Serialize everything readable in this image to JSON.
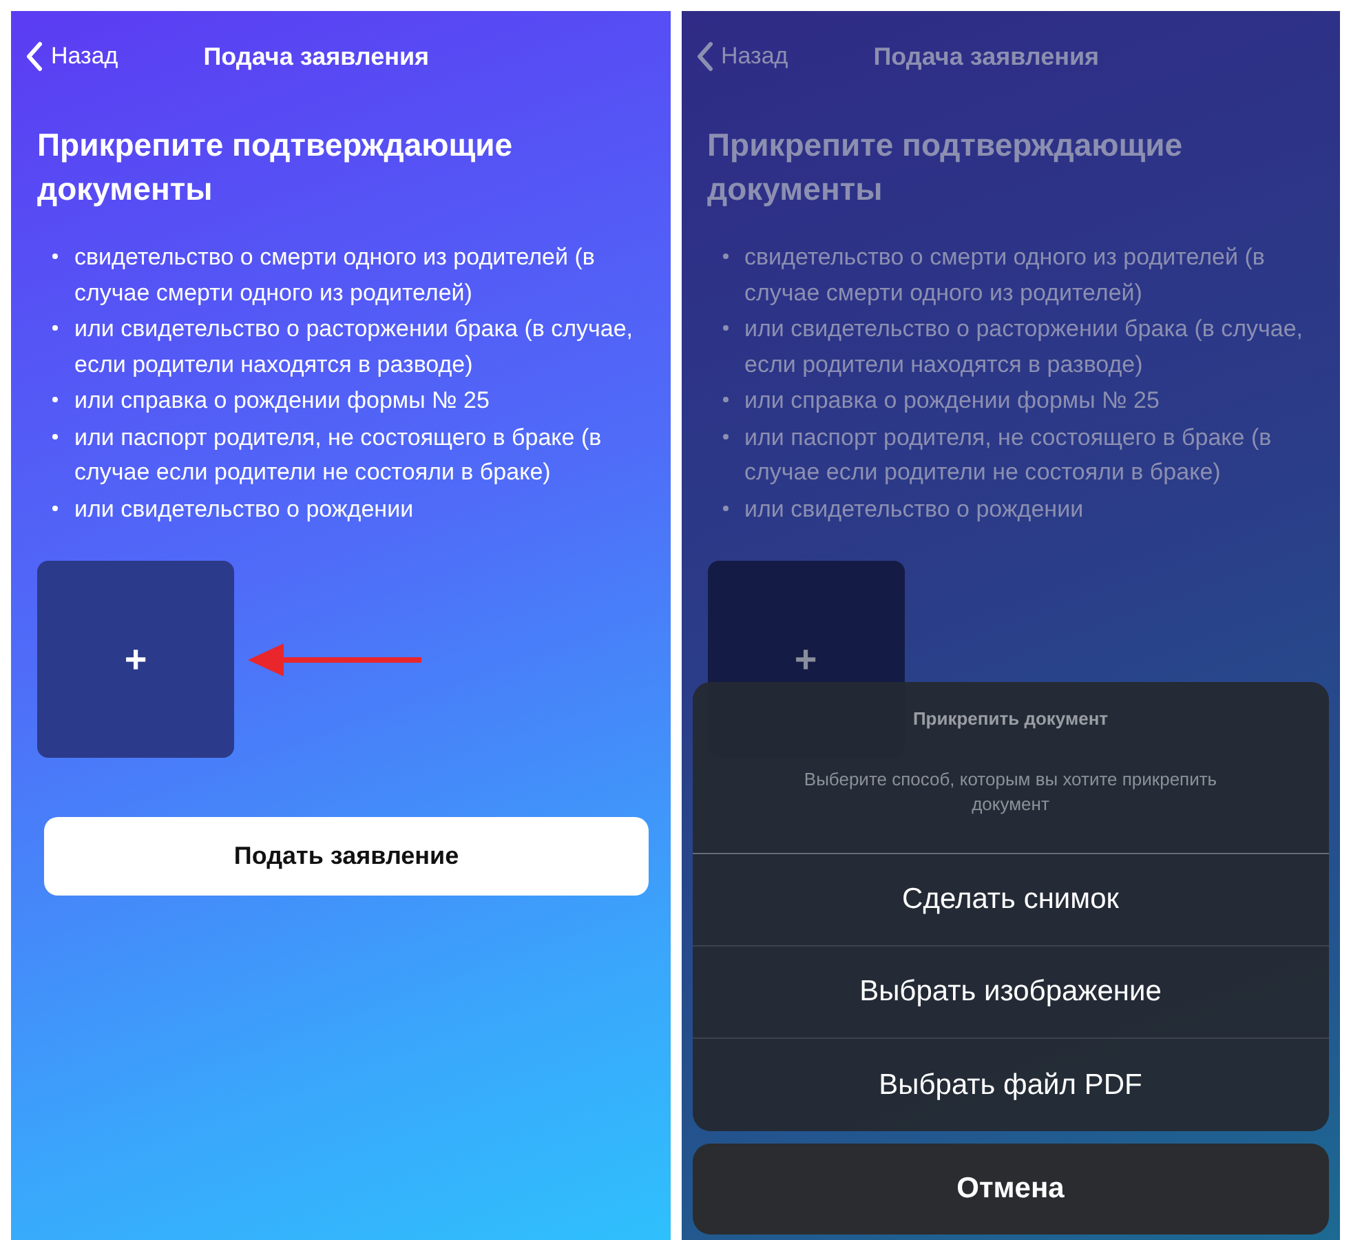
{
  "screens": [
    {
      "dimmed": false,
      "nav": {
        "back": "Назад",
        "title": "Подача заявления"
      },
      "heading": "Прикрепите подтверждающие документы",
      "documents": [
        "свидетельство о смерти одного из родителей (в случае смерти одного из родителей)",
        "или свидетельство о расторжении брака (в случае, если родители находятся в разводе)",
        "или справка о рождении формы № 25",
        "или паспорт родителя, не состоящего в браке (в случае если родители не состояли в браке)",
        "или свидетельство о рождении"
      ],
      "upload_tile": {
        "label": "+"
      },
      "pointer_arrow": true,
      "submit_button": "Подать заявление"
    },
    {
      "dimmed": true,
      "nav": {
        "back": "Назад",
        "title": "Подача заявления"
      },
      "heading": "Прикрепите подтверждающие документы",
      "documents": [
        "свидетельство о смерти одного из родителей (в случае смерти одного из родителей)",
        "или свидетельство о расторжении брака (в случае, если родители находятся в разводе)",
        "или справка о рождении формы № 25",
        "или паспорт родителя, не состоящего в браке (в случае если родители не состояли в браке)",
        "или свидетельство о рождении"
      ],
      "upload_tile": {
        "label": "+"
      },
      "action_sheet": {
        "title": "Прикрепить документ",
        "message": "Выберите способ, которым вы хотите прикрепить документ",
        "options": [
          "Сделать снимок",
          "Выбрать изображение",
          "Выбрать файл PDF"
        ],
        "cancel": "Отмена"
      }
    }
  ]
}
